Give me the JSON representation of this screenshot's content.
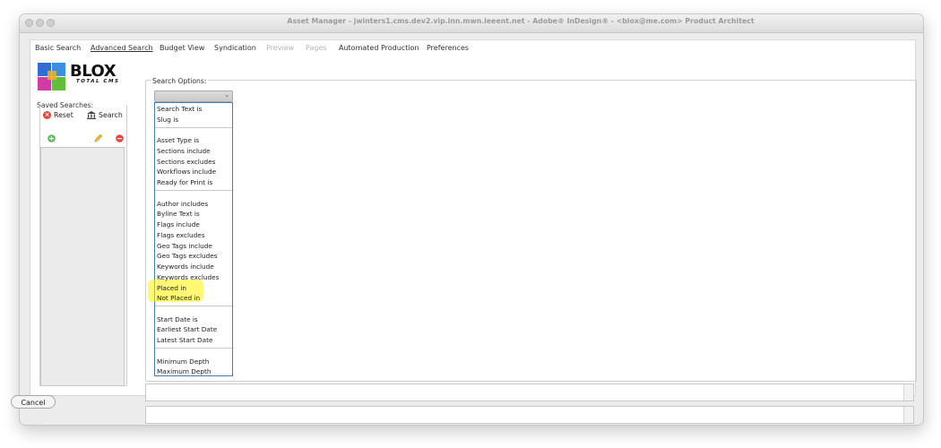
{
  "window": {
    "title": "Asset Manager - jwinters1.cms.dev2.vip.inn.mwn.leeent.net - Adobe® InDesign® - <blox@me.com> Product Architect"
  },
  "tabs": [
    {
      "label": "Basic Search"
    },
    {
      "label": "Advanced Search"
    },
    {
      "label": "Budget View"
    },
    {
      "label": "Syndication"
    },
    {
      "label": "Preview"
    },
    {
      "label": "Pages"
    },
    {
      "label": "Automated Production"
    },
    {
      "label": "Preferences"
    }
  ],
  "logo": {
    "text": "BLOX",
    "subtext": "TOTAL CMS"
  },
  "saved_searches": {
    "label": "Saved Searches:",
    "reset_label": "Reset",
    "search_label": "Search"
  },
  "search_options": {
    "label": "Search Options:",
    "dropdown_items": [
      "Search Text is",
      "Slug is",
      "Asset Type is",
      "Sections include",
      "Sections excludes",
      "Workflows include",
      "Ready for Print is",
      "Author includes",
      "Byline Text is",
      "Flags include",
      "Flags excludes",
      "Geo Tags include",
      "Geo Tags excludes",
      "Keywords include",
      "Keywords excludes",
      "Placed in",
      "Not Placed in",
      "Start Date is",
      "Earliest Start Date",
      "Latest Start Date",
      "Minimum Depth",
      "Maximum Depth"
    ]
  },
  "buttons": {
    "cancel_label": "Cancel"
  },
  "colors": {
    "highlight": "#fff200",
    "dropdown_border": "#4a78b5",
    "reset_icon": "#e2463c"
  }
}
